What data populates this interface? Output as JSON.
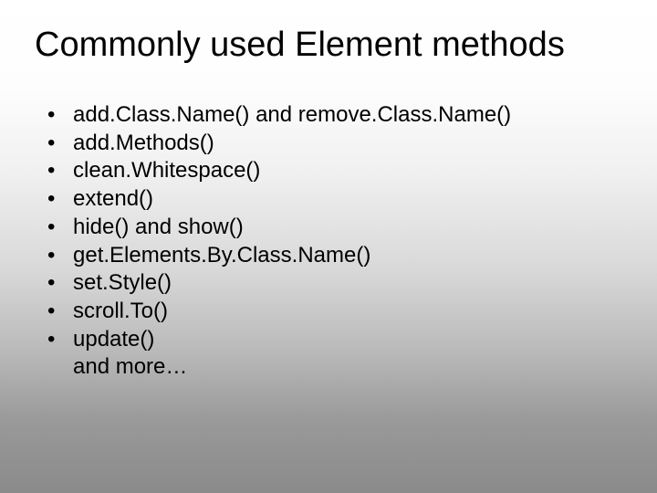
{
  "title": "Commonly used Element methods",
  "bullet_char": "•",
  "items": [
    "add.Class.Name() and remove.Class.Name()",
    "add.Methods()",
    "clean.Whitespace()",
    "extend()",
    "hide() and show()",
    "get.Elements.By.Class.Name()",
    "set.Style()",
    "scroll.To()",
    "update()"
  ],
  "trailing": "and more…"
}
